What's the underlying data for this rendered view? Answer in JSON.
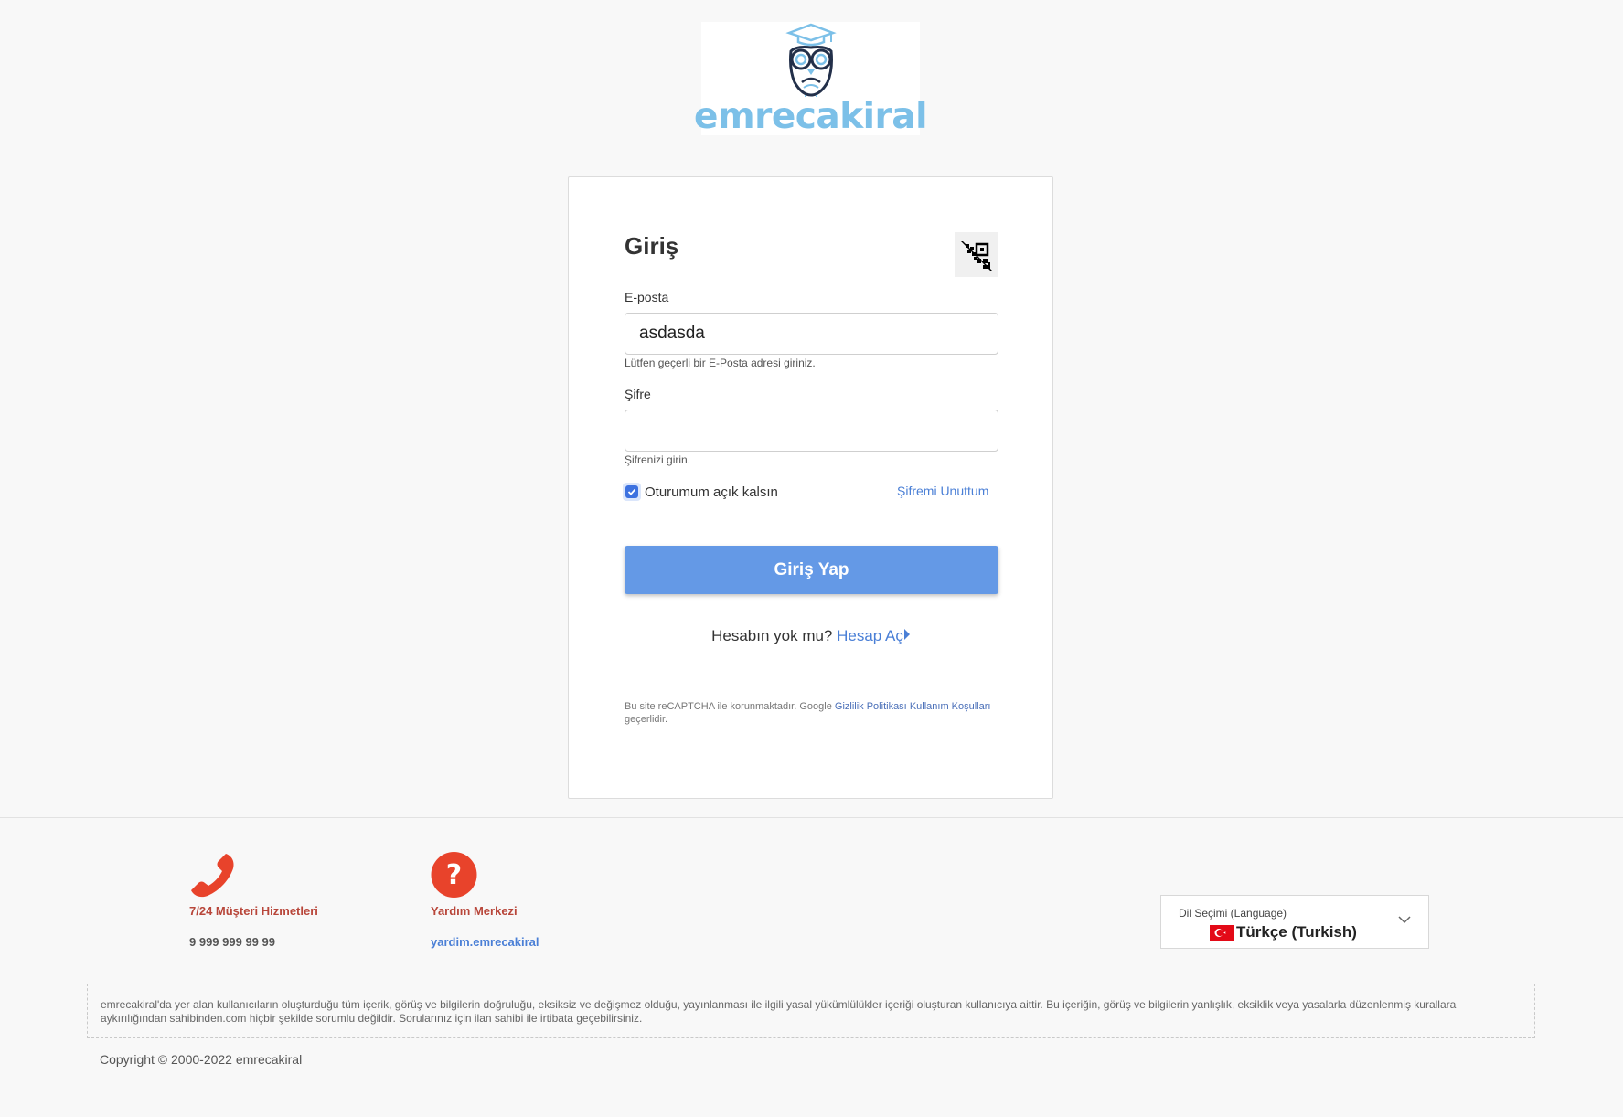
{
  "brand": {
    "logo_text": "emrecakiral"
  },
  "login": {
    "title": "Giriş",
    "qr_icon": "qr-code-icon",
    "email": {
      "label": "E-posta",
      "value": "asdasda",
      "hint": "Lütfen geçerli bir E-Posta adresi giriniz."
    },
    "password": {
      "label": "Şifre",
      "value": "",
      "hint": "Şifrenizi girin."
    },
    "remember": {
      "label": "Oturumum açık kalsın",
      "checked": true
    },
    "forgot_label": "Şifremi Unuttum",
    "submit_label": "Giriş Yap",
    "signup": {
      "prompt": "Hesabın yok mu?",
      "link": "Hesap Aç"
    },
    "recaptcha": {
      "prefix": "Bu site reCAPTCHA ile korunmaktadır. Google",
      "privacy": "Gizlilik Politikası",
      "terms": "Kullanım Koşulları",
      "suffix": "geçerlidir."
    }
  },
  "footer": {
    "customer_service": {
      "title": "7/24 Müşteri Hizmetleri",
      "value": "9 999 999 99 99",
      "icon": "phone-icon"
    },
    "help_center": {
      "title": "Yardım Merkezi",
      "value": "yardim.emrecakiral",
      "icon": "question-icon"
    },
    "language": {
      "label": "Dil Seçimi (Language)",
      "value": "Türkçe (Turkish)",
      "icon": "turkey-flag-icon"
    },
    "disclaimer": "emrecakiral'da yer alan kullanıcıların oluşturduğu tüm içerik, görüş ve bilgilerin doğruluğu, eksiksiz ve değişmez olduğu, yayınlanması ile ilgili yasal yükümlülükler içeriği oluşturan kullanıcıya aittir. Bu içeriğin, görüş ve bilgilerin yanlışlık, eksiklik veya yasalarla düzenlenmiş kurallara aykırılığından sahibinden.com hiçbir şekilde sorumlu değildir. Sorularınız için ilan sahibi ile irtibata geçebilirsiniz.",
    "copyright": "Copyright © 2000-2022 emrecakiral"
  },
  "colors": {
    "accent": "#6499e6",
    "link": "#4a7fd6",
    "footer_title": "#b8463a",
    "icon_red": "#e8432b"
  }
}
